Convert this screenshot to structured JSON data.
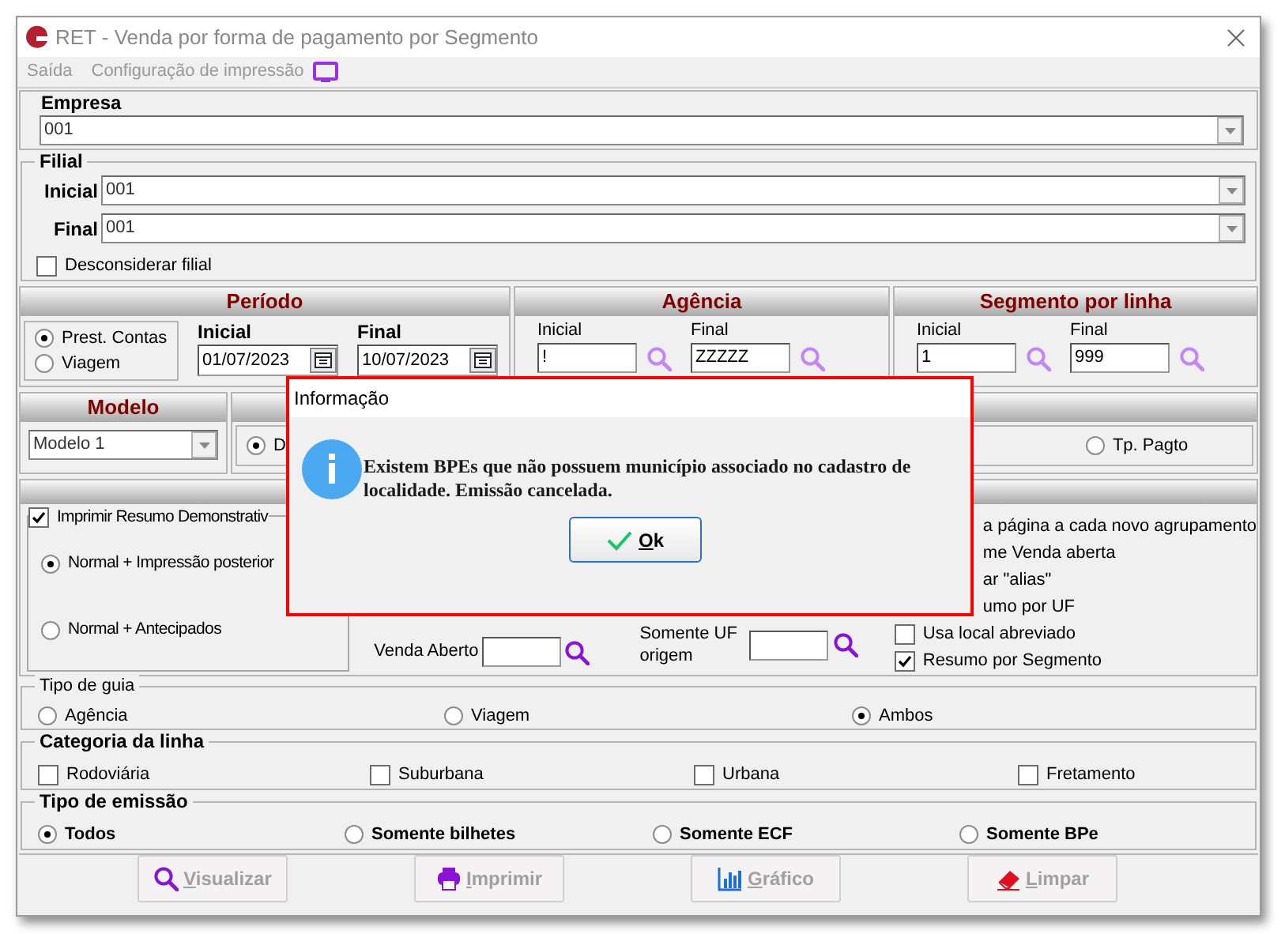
{
  "window": {
    "title": "RET - Venda por forma de pagamento por Segmento"
  },
  "menu": [
    {
      "label": "Saída"
    },
    {
      "label": "Configuração de impressão"
    }
  ],
  "empresa": {
    "label": "Empresa",
    "value": "001"
  },
  "filial": {
    "legend": "Filial",
    "inicial": {
      "label": "Inicial",
      "value": "001"
    },
    "final": {
      "label": "Final",
      "value": "001"
    },
    "desconsiderar": {
      "label": "Desconsiderar filial",
      "checked": false
    }
  },
  "periodo": {
    "title": "Período",
    "options": [
      {
        "label": "Prest. Contas",
        "selected": true
      },
      {
        "label": "Viagem",
        "selected": false
      }
    ],
    "inicial": {
      "label": "Inicial",
      "value": "01/07/2023"
    },
    "final": {
      "label": "Final",
      "value": "10/07/2023"
    }
  },
  "agencia": {
    "title": "Agência",
    "inicial": {
      "label": "Inicial",
      "value": "!"
    },
    "final": {
      "label": "Final",
      "value": "ZZZZZ"
    }
  },
  "segmento": {
    "title": "Segmento por linha",
    "inicial": {
      "label": "Inicial",
      "value": "1"
    },
    "final": {
      "label": "Final",
      "value": "999"
    }
  },
  "modelo": {
    "title": "Modelo",
    "value": "Modelo 1"
  },
  "agrupamento": {
    "options": [
      {
        "label": "D",
        "selected": true
      },
      {
        "label": "Tp. Pagto",
        "selected": false
      }
    ]
  },
  "opcoes": {
    "resumo": {
      "label": "Imprimir Resumo Demonstrativ",
      "checked": true
    },
    "modes": [
      {
        "label": "Normal + Impressão posterior",
        "selected": true
      },
      {
        "label": "Normal + Antecipados",
        "selected": false
      }
    ],
    "venda_aberto": {
      "label": "Venda Aberto"
    },
    "uf_origem": {
      "label": "Somente UF origem"
    },
    "flags": [
      {
        "kind": "text",
        "label": "a página a cada novo agrupamento"
      },
      {
        "kind": "text",
        "label": "me Venda aberta"
      },
      {
        "kind": "text",
        "label": "ar \"alias\""
      },
      {
        "kind": "text",
        "label": "umo por UF"
      },
      {
        "kind": "checkbox",
        "label": "Usa local abreviado",
        "checked": false
      },
      {
        "kind": "checkbox",
        "label": "Resumo por Segmento",
        "checked": true
      }
    ]
  },
  "tipo_guia": {
    "legend": "Tipo de guia",
    "options": [
      {
        "label": "Agência",
        "selected": false
      },
      {
        "label": "Viagem",
        "selected": false
      },
      {
        "label": "Ambos",
        "selected": true
      }
    ]
  },
  "categoria": {
    "legend": "Categoria da linha",
    "items": [
      {
        "label": "Rodoviária",
        "checked": false
      },
      {
        "label": "Suburbana",
        "checked": false
      },
      {
        "label": "Urbana",
        "checked": false
      },
      {
        "label": "Fretamento",
        "checked": false
      }
    ]
  },
  "tipo_emissao": {
    "legend": "Tipo de emissão",
    "options": [
      {
        "label": "Todos",
        "selected": true
      },
      {
        "label": "Somente bilhetes",
        "selected": false
      },
      {
        "label": "Somente ECF",
        "selected": false
      },
      {
        "label": "Somente BPe",
        "selected": false
      }
    ]
  },
  "buttons": [
    {
      "label": "Visualizar",
      "kind": "search",
      "disabled": true
    },
    {
      "label": "Imprimir",
      "kind": "print",
      "disabled": true
    },
    {
      "label": "Gráfico",
      "kind": "chart",
      "disabled": true
    },
    {
      "label": "Limpar",
      "kind": "eraser",
      "disabled": true
    }
  ],
  "dialog": {
    "title": "Informação",
    "message": "Existem BPEs que não possuem município associado no cadastro de localidade. Emissão cancelada.",
    "button": "Ok"
  }
}
